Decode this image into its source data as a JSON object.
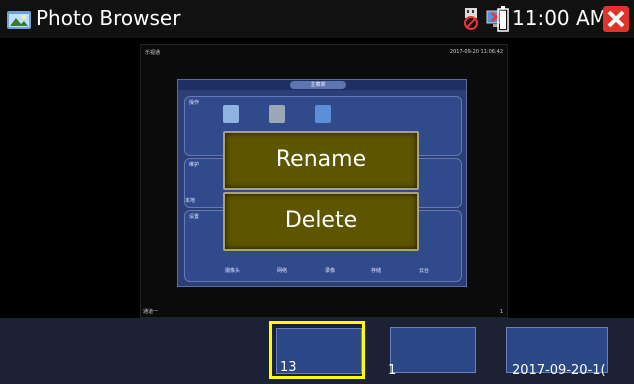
{
  "titlebar": {
    "title": "Photo Browser",
    "time": "11:00 AM",
    "icons": [
      "photo-browser-app-icon",
      "usb-disconnected-icon",
      "network-disconnected-icon",
      "battery-icon",
      "close-icon"
    ]
  },
  "preview": {
    "top_left_label": "乐视通",
    "timestamp": "2017-09-20 11:06:42",
    "menu_title": "主菜单",
    "group1_label": "操作",
    "group2_label": "维护",
    "group3_label": "设置",
    "side_text": "本地",
    "captions": [
      "摄像头",
      "网络",
      "录像",
      "存储",
      "云台"
    ],
    "bottom_left_label": "通道一",
    "bottom_right_label": "1"
  },
  "menu": {
    "rename_label": "Rename",
    "delete_label": "Delete"
  },
  "thumbnails": [
    {
      "label": "13",
      "selected": true
    },
    {
      "label": "1",
      "selected": false
    },
    {
      "label": "2017-09-20-1(",
      "selected": false
    }
  ],
  "colors": {
    "menu_button": "#5e5500",
    "selection": "#ffff00",
    "close": "#e0332a",
    "strip": "#1c2233"
  }
}
